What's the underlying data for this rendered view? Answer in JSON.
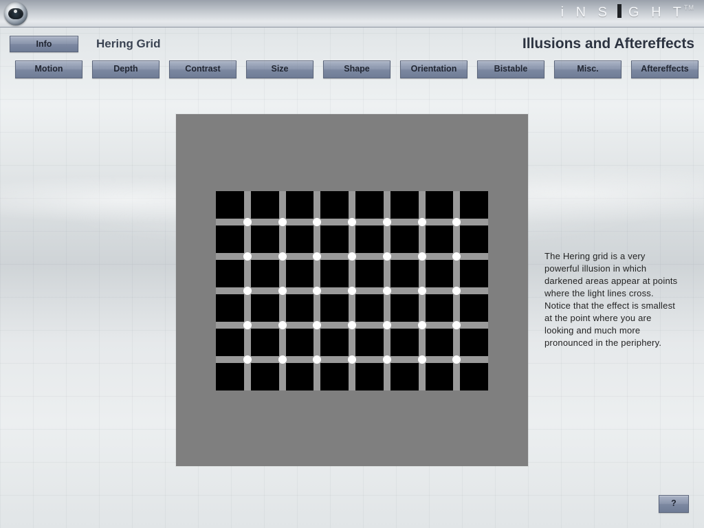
{
  "brand": {
    "name_letters": "iNS GHT",
    "tm": "TM"
  },
  "header": {
    "info_label": "Info",
    "subtitle": "Hering Grid",
    "title": "Illusions and Aftereffects"
  },
  "tabs": [
    {
      "label": "Motion"
    },
    {
      "label": "Depth"
    },
    {
      "label": "Contrast"
    },
    {
      "label": "Size"
    },
    {
      "label": "Shape"
    },
    {
      "label": "Orientation"
    },
    {
      "label": "Bistable"
    },
    {
      "label": "Misc."
    },
    {
      "label": "Aftereffects"
    }
  ],
  "illusion": {
    "name": "Hering Grid",
    "grid": {
      "cols": 8,
      "rows": 6,
      "line_thickness_px": 10,
      "square_color": "#000000",
      "line_color": "#9a9a9a",
      "dot_color": "#ffffff"
    }
  },
  "description": "The Hering grid is a very powerful illusion in which darkened areas appear at points where the light lines cross. Notice that the effect is smallest at the point where you are looking and much more pronounced in the periphery.",
  "help_label": "?"
}
